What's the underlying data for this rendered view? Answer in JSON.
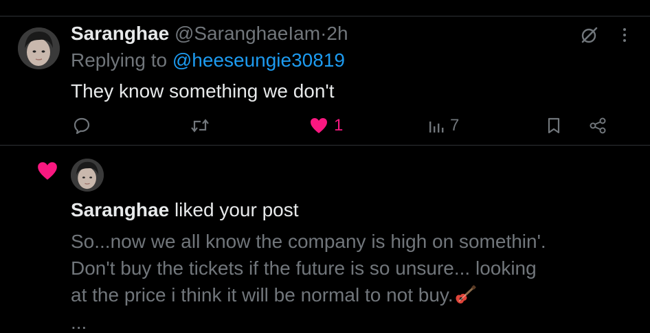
{
  "reply_post": {
    "author_name": "Saranghae",
    "author_handle": "@SaranghaeIam",
    "separator": "·",
    "time": "2h",
    "replying_prefix": "Replying to",
    "replying_to": "@heeseungie30819",
    "text": "They know something we don't",
    "actions": {
      "reply_count": "",
      "retweet_count": "",
      "like_count": "1",
      "view_count": "7"
    },
    "icons": [
      "grok-icon",
      "more-icon",
      "reply-icon",
      "retweet-icon",
      "heart-icon",
      "views-icon",
      "bookmark-icon",
      "share-icon"
    ]
  },
  "notification": {
    "icon": "heart-icon",
    "user_name": "Saranghae",
    "action_text": "liked your post",
    "post_lines": [
      "So...now we all know the company is high on somethin'.",
      "Don't buy the tickets if the future is so unsure... looking",
      "at the price i think it will be normal to not buy."
    ],
    "trailing_emoji": "guitar-emoji",
    "truncation": "..."
  },
  "colors": {
    "background": "#000000",
    "text": "#e7e9ea",
    "muted": "#71767b",
    "link": "#1d9bf0",
    "like": "#f91880",
    "divider": "#2f3336"
  }
}
